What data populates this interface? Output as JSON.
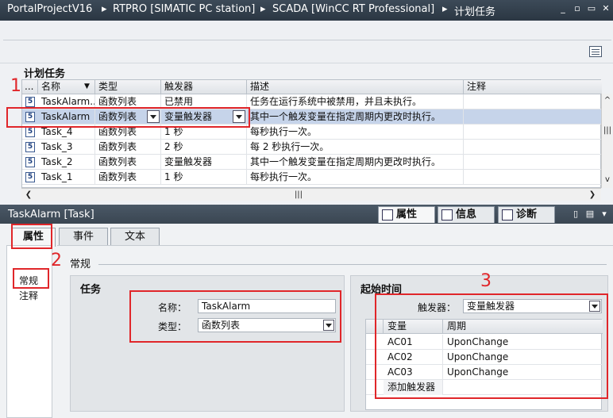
{
  "titlebar": {
    "project": "PortalProjectV16",
    "crumbs": [
      "RTPRO [SIMATIC PC station]",
      "SCADA [WinCC RT Professional]",
      "计划任务"
    ],
    "separator": "▸",
    "controls": [
      "_",
      "▫",
      "▭",
      "✕"
    ]
  },
  "page_title": "计划任务",
  "table": {
    "headers": [
      "...",
      "名称",
      "类型",
      "触发器",
      "描述",
      "注释"
    ],
    "sort_indicator": "▼",
    "rows": [
      {
        "icon": "5",
        "name": "TaskAlarm...",
        "type": "函数列表",
        "trigger": "已禁用",
        "description": "任务在运行系统中被禁用，并且未执行。",
        "comment": ""
      },
      {
        "icon": "5",
        "name": "TaskAlarm",
        "type": "函数列表",
        "trigger": "变量触发器",
        "description": "其中一个触发变量在指定周期内更改时执行。",
        "comment": "",
        "selected": true
      },
      {
        "icon": "5",
        "name": "Task_4",
        "type": "函数列表",
        "trigger": "1 秒",
        "description": "每秒执行一次。",
        "comment": ""
      },
      {
        "icon": "5",
        "name": "Task_3",
        "type": "函数列表",
        "trigger": "2 秒",
        "description": "每 2 秒执行一次。",
        "comment": ""
      },
      {
        "icon": "5",
        "name": "Task_2",
        "type": "函数列表",
        "trigger": "变量触发器",
        "description": "其中一个触发变量在指定周期内更改时执行。",
        "comment": ""
      },
      {
        "icon": "5",
        "name": "Task_1",
        "type": "函数列表",
        "trigger": "1 秒",
        "description": "每秒执行一次。",
        "comment": ""
      }
    ]
  },
  "scroll": {
    "left": "❮",
    "right": "❯",
    "up": "^",
    "down": "v",
    "grip": "|||"
  },
  "inspector": {
    "title": "TaskAlarm [Task]",
    "tabs": [
      "属性",
      "信息",
      "诊断"
    ],
    "header_controls": [
      "▯",
      "▤",
      "▾"
    ]
  },
  "subtabs": [
    "属性",
    "事件",
    "文本"
  ],
  "leftnav": [
    "常规",
    "注释"
  ],
  "general_title": "常规",
  "task_group": {
    "title": "任务",
    "name_label": "名称：",
    "name_value": "TaskAlarm",
    "type_label": "类型：",
    "type_value": "函数列表"
  },
  "start_group": {
    "title": "起始时间",
    "trigger_label": "触发器：",
    "trigger_value": "变量触发器",
    "headers": [
      "变量",
      "周期"
    ],
    "rows": [
      {
        "var": "AC01",
        "cycle": "UponChange"
      },
      {
        "var": "AC02",
        "cycle": "UponChange"
      },
      {
        "var": "AC03",
        "cycle": "UponChange"
      }
    ],
    "add_label": "添加触发器"
  },
  "annotations": [
    "1",
    "2",
    "3"
  ],
  "colors": {
    "highlight": "#e0262a",
    "selection": "#c6d4ea",
    "titlebar": "#2c3844"
  }
}
